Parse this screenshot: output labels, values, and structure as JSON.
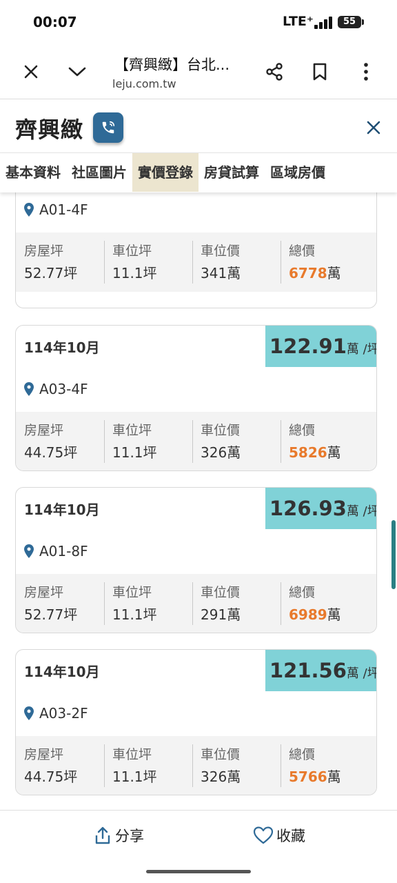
{
  "status_bar": {
    "time": "00:07",
    "network": "LTE⁺",
    "battery": "55"
  },
  "browser": {
    "page_title": "【齊興緻】台北...",
    "url": "leju.com.tw"
  },
  "site": {
    "title": "齊興緻"
  },
  "tabs": [
    {
      "label": "基本資料",
      "active": false
    },
    {
      "label": "社區圖片",
      "active": false
    },
    {
      "label": "實價登錄",
      "active": true
    },
    {
      "label": "房貸試算",
      "active": false
    },
    {
      "label": "區域房價",
      "active": false
    }
  ],
  "stat_labels": {
    "house_ping": "房屋坪",
    "parking_ping": "車位坪",
    "parking_price": "車位價",
    "total_price": "總價"
  },
  "units": {
    "price_unit": "萬 /坪",
    "ping": "坪",
    "wan": "萬"
  },
  "transactions": [
    {
      "date": "",
      "price": "",
      "unit_label": "A01-4F",
      "house_ping": "52.77",
      "parking_ping": "11.1",
      "parking_price": "341",
      "total_price": "6778"
    },
    {
      "date": "114年10月",
      "price": "122.91",
      "unit_label": "A03-4F",
      "house_ping": "44.75",
      "parking_ping": "11.1",
      "parking_price": "326",
      "total_price": "5826"
    },
    {
      "date": "114年10月",
      "price": "126.93",
      "unit_label": "A01-8F",
      "house_ping": "52.77",
      "parking_ping": "11.1",
      "parking_price": "291",
      "total_price": "6989"
    },
    {
      "date": "114年10月",
      "price": "121.56",
      "unit_label": "A03-2F",
      "house_ping": "44.75",
      "parking_ping": "11.1",
      "parking_price": "326",
      "total_price": "5766"
    }
  ],
  "bottom": {
    "share_label": "分享",
    "favorite_label": "收藏"
  },
  "colors": {
    "accent_teal": "#80d2d7",
    "total_price_orange": "#e87a2c",
    "active_tab": "#ece5cf",
    "phone_button": "#2f6a97"
  }
}
